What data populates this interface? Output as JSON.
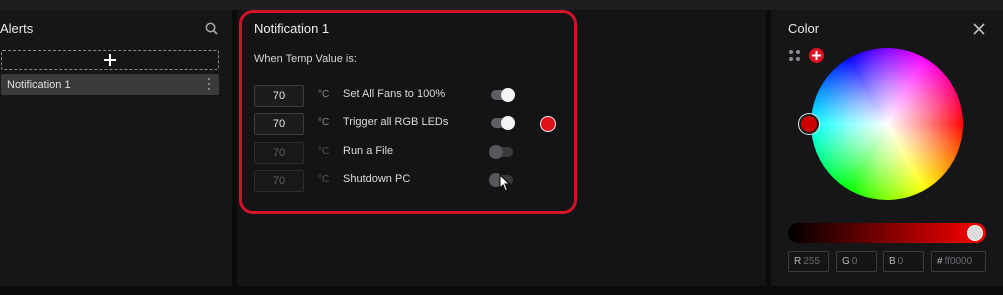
{
  "alerts": {
    "title": "Alerts",
    "search_icon": "search-icon",
    "add_icon": "plus-icon",
    "items": [
      {
        "label": "Notification 1",
        "menu_icon": "more-vertical-icon"
      }
    ]
  },
  "notification": {
    "title": "Notification 1",
    "condition_label": "When Temp Value is:",
    "rows": [
      {
        "temp": "70",
        "unit": "°C",
        "action": "Set All Fans to 100%",
        "enabled": true
      },
      {
        "temp": "70",
        "unit": "°C",
        "action": "Trigger all RGB LEDs",
        "enabled": true,
        "color": "#e0101b"
      },
      {
        "temp": "70",
        "unit": "°C",
        "action": "Run a File",
        "enabled": false
      },
      {
        "temp": "70",
        "unit": "°C",
        "action": "Shutdown PC",
        "enabled": false
      }
    ],
    "highlight_color": "#d3122a"
  },
  "color": {
    "title": "Color",
    "close_icon": "close-icon",
    "selected": "#ff0000",
    "fields": {
      "r_label": "R",
      "r_value": "255",
      "g_label": "G",
      "g_value": "0",
      "b_label": "B",
      "b_value": "0",
      "hex_label": "#",
      "hex_value": "ff0000"
    }
  }
}
